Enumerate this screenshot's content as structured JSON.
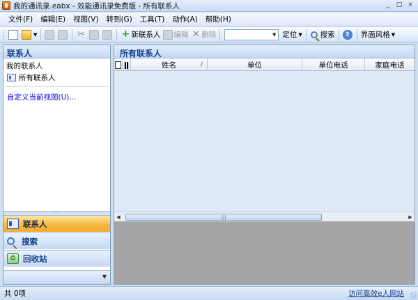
{
  "window": {
    "title": "我的通讯录.eabx - 效能通讯录免费版 - 所有联系人",
    "controls": [
      "_",
      "□",
      "×"
    ]
  },
  "menu": [
    "文件(F)",
    "编辑(E)",
    "视图(V)",
    "转到(G)",
    "工具(T)",
    "动作(A)",
    "帮助(H)"
  ],
  "toolbar": {
    "new_contact": "新联系人",
    "edit": "编辑",
    "delete": "删除",
    "search_combo_value": "",
    "locate": "定位",
    "search": "搜索",
    "ui_style": "界面风格"
  },
  "left_panel": {
    "header": "联系人",
    "group_title": "我的联系人",
    "all_contacts": "所有联系人",
    "custom_view": "自定义当前视图(U)...",
    "nav": {
      "contacts": "联系人",
      "search": "搜索",
      "recycle": "回收站"
    }
  },
  "right_panel": {
    "header": "所有联系人",
    "columns": [
      "",
      "",
      "姓名",
      "单位",
      "单位电话",
      "家庭电话"
    ]
  },
  "statusbar": {
    "count": "共 0项",
    "link": "访问高效e人网站"
  },
  "colors": {
    "active_nav": "#f7b844",
    "header_text": "#15428b",
    "grid_bg": "#dfe9f7",
    "empty_area": "#a5a5a5"
  }
}
